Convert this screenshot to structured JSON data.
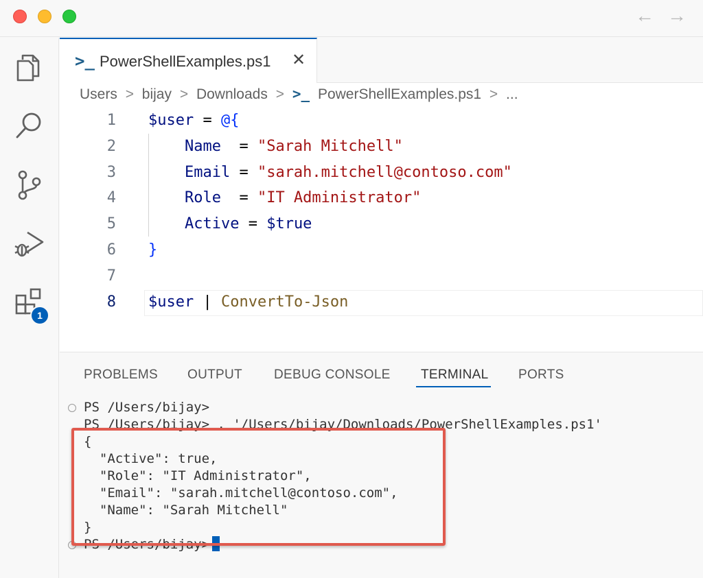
{
  "window": {
    "nav_back": "←",
    "nav_forward": "→"
  },
  "activity_bar": {
    "items": [
      "explorer-icon",
      "search-icon",
      "source-control-icon",
      "run-debug-icon",
      "extensions-icon"
    ],
    "extensions_badge": "1"
  },
  "tab": {
    "icon": ">_",
    "label": "PowerShellExamples.ps1",
    "close": "✕"
  },
  "breadcrumb": {
    "items": [
      "Users",
      "bijay",
      "Downloads",
      "PowerShellExamples.ps1",
      "..."
    ],
    "separator": ">",
    "ps_icon": ">_"
  },
  "code": {
    "line_numbers": [
      "1",
      "2",
      "3",
      "4",
      "5",
      "6",
      "7",
      "8"
    ],
    "lines": [
      [
        {
          "t": "$user",
          "c": "var"
        },
        {
          "t": " = ",
          "c": "op"
        },
        {
          "t": "@{",
          "c": "br"
        }
      ],
      [
        {
          "t": "    Name  ",
          "c": "var"
        },
        {
          "t": "= ",
          "c": "op"
        },
        {
          "t": "\"Sarah Mitchell\"",
          "c": "str"
        }
      ],
      [
        {
          "t": "    Email ",
          "c": "var"
        },
        {
          "t": "= ",
          "c": "op"
        },
        {
          "t": "\"sarah.mitchell@contoso.com\"",
          "c": "str"
        }
      ],
      [
        {
          "t": "    Role  ",
          "c": "var"
        },
        {
          "t": "= ",
          "c": "op"
        },
        {
          "t": "\"IT Administrator\"",
          "c": "str"
        }
      ],
      [
        {
          "t": "    Active ",
          "c": "var"
        },
        {
          "t": "= ",
          "c": "op"
        },
        {
          "t": "$true",
          "c": "var"
        }
      ],
      [
        {
          "t": "}",
          "c": "br"
        }
      ],
      [],
      [
        {
          "t": "$user",
          "c": "var"
        },
        {
          "t": " | ",
          "c": "op"
        },
        {
          "t": "ConvertTo-Json",
          "c": "fn"
        }
      ]
    ],
    "active_line": "8"
  },
  "panel": {
    "tabs": [
      "PROBLEMS",
      "OUTPUT",
      "DEBUG CONSOLE",
      "TERMINAL",
      "PORTS"
    ],
    "active_tab": "TERMINAL"
  },
  "terminal": {
    "lines": [
      "PS /Users/bijay>",
      "PS /Users/bijay> . '/Users/bijay/Downloads/PowerShellExamples.ps1'",
      "{",
      "  \"Active\": true,",
      "  \"Role\": \"IT Administrator\",",
      "  \"Email\": \"sarah.mitchell@contoso.com\",",
      "  \"Name\": \"Sarah Mitchell\"",
      "}",
      "PS /Users/bijay>"
    ]
  },
  "colors": {
    "accent": "#005fb8",
    "highlight_box": "#e05a4e",
    "string": "#a31515",
    "variable": "#001080",
    "function": "#795e26"
  }
}
